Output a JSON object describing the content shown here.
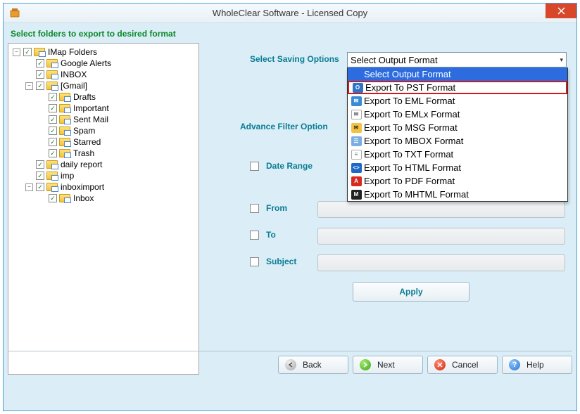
{
  "window": {
    "title": "WholeClear Software - Licensed Copy"
  },
  "instruction": "Select folders to export to desired format",
  "tree": {
    "root": "IMap Folders",
    "nodes": {
      "googleAlerts": "Google Alerts",
      "inbox": "INBOX",
      "gmail": "[Gmail]",
      "drafts": "Drafts",
      "important": "Important",
      "sentMail": "Sent Mail",
      "spam": "Spam",
      "starred": "Starred",
      "trash": "Trash",
      "dailyReport": "daily report",
      "imp": "imp",
      "inboxImport": "inboximport",
      "inbox2": "Inbox"
    }
  },
  "labels": {
    "selectSaving": "Select Saving Options",
    "advanceFilter": "Advance Filter Option",
    "dateRange": "Date Range",
    "from": "From",
    "to": "To",
    "subject": "Subject",
    "apply": "Apply"
  },
  "dropdown": {
    "current": "Select Output Format",
    "options": [
      "Select Output Format",
      "Export To PST Format",
      "Export To EML Format",
      "Export To EMLx Format",
      "Export To MSG Format",
      "Export To MBOX Format",
      "Export To TXT Format",
      "Export To HTML Format",
      "Export To PDF Format",
      "Export To MHTML Format"
    ]
  },
  "footer": {
    "back": "Back",
    "next": "Next",
    "cancel": "Cancel",
    "help": "Help"
  }
}
